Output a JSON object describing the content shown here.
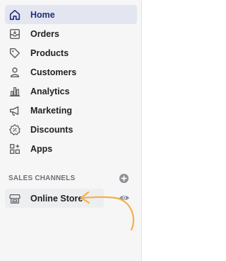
{
  "nav": {
    "items": [
      {
        "label": "Home",
        "icon": "home-icon",
        "active": true
      },
      {
        "label": "Orders",
        "icon": "orders-icon"
      },
      {
        "label": "Products",
        "icon": "tag-icon"
      },
      {
        "label": "Customers",
        "icon": "person-icon"
      },
      {
        "label": "Analytics",
        "icon": "bar-chart-icon"
      },
      {
        "label": "Marketing",
        "icon": "megaphone-icon"
      },
      {
        "label": "Discounts",
        "icon": "discount-icon"
      },
      {
        "label": "Apps",
        "icon": "apps-icon"
      }
    ]
  },
  "sales_channels": {
    "title": "SALES CHANNELS",
    "add_icon": "plus-circle-icon",
    "items": [
      {
        "label": "Online Store",
        "icon": "store-icon",
        "view_icon": "eye-icon"
      }
    ]
  },
  "colors": {
    "sidebar_bg": "#f6f6f7",
    "active_bg": "#e3e6f0",
    "active_text": "#202e78",
    "annotation_arrow": "#f5b04c"
  }
}
